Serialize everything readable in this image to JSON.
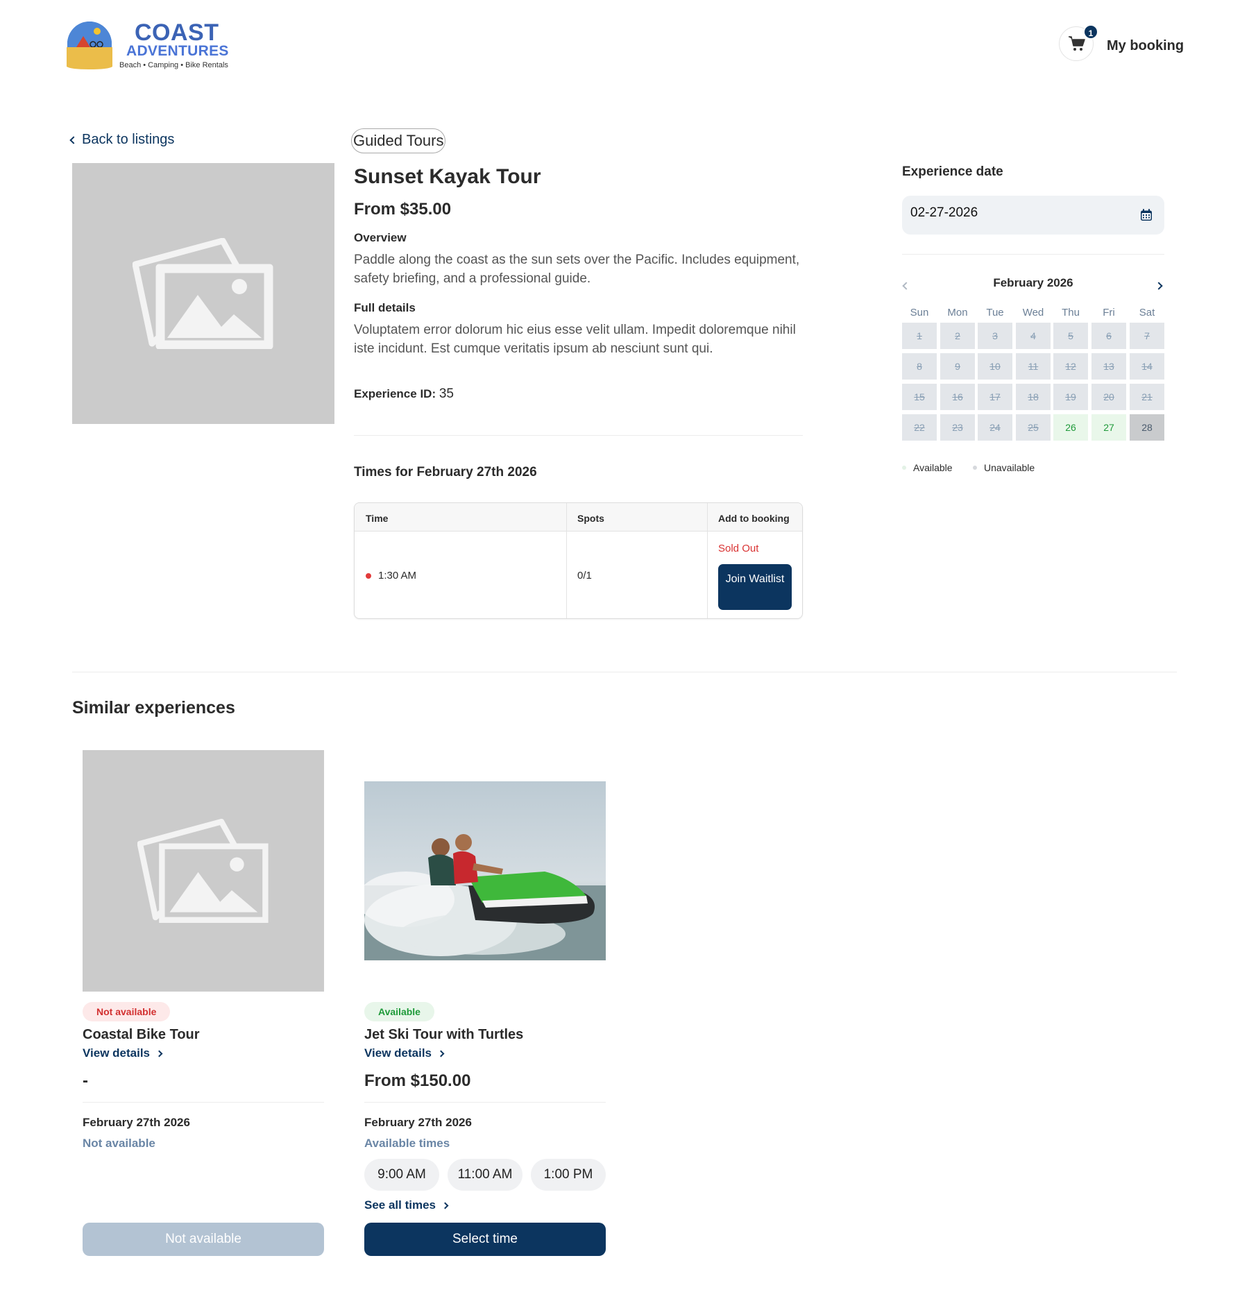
{
  "brand": {
    "name_line1": "COAST",
    "name_line2": "ADVENTURES",
    "tagline": "Beach • Camping • Bike Rentals"
  },
  "header": {
    "cart_count": "1",
    "my_booking_label": "My booking"
  },
  "back_label": "Back to listings",
  "experience": {
    "category": "Guided Tours",
    "title": "Sunset Kayak Tour",
    "price": "From $35.00",
    "overview_label": "Overview",
    "overview_text": "Paddle along the coast as the sun sets over the Pacific. Includes equipment, safety briefing, and a professional guide.",
    "full_details_label": "Full details",
    "full_details_text": "Voluptatem error dolorum hic eius esse velit ullam. Impedit doloremque nihil iste incidunt. Est cumque veritatis ipsum ab nesciunt sunt qui.",
    "id_label": "Experience ID:",
    "id_value": "35"
  },
  "times": {
    "heading": "Times for February 27th 2026",
    "headers": [
      "Time",
      "Spots",
      "Add to booking"
    ],
    "rows": [
      {
        "time": "1:30 AM",
        "spots": "0/1",
        "status": "Sold Out",
        "action": "Join Waitlist"
      }
    ]
  },
  "date_picker": {
    "label": "Experience date",
    "value": "02-27-2026",
    "month": "February 2026",
    "weekdays": [
      "Sun",
      "Mon",
      "Tue",
      "Wed",
      "Thu",
      "Fri",
      "Sat"
    ],
    "days": [
      {
        "d": "1",
        "s": "unavailable"
      },
      {
        "d": "2",
        "s": "unavailable"
      },
      {
        "d": "3",
        "s": "unavailable"
      },
      {
        "d": "4",
        "s": "unavailable"
      },
      {
        "d": "5",
        "s": "unavailable"
      },
      {
        "d": "6",
        "s": "unavailable"
      },
      {
        "d": "7",
        "s": "unavailable"
      },
      {
        "d": "8",
        "s": "unavailable"
      },
      {
        "d": "9",
        "s": "unavailable"
      },
      {
        "d": "10",
        "s": "unavailable"
      },
      {
        "d": "11",
        "s": "unavailable"
      },
      {
        "d": "12",
        "s": "unavailable"
      },
      {
        "d": "13",
        "s": "unavailable"
      },
      {
        "d": "14",
        "s": "unavailable"
      },
      {
        "d": "15",
        "s": "unavailable"
      },
      {
        "d": "16",
        "s": "unavailable"
      },
      {
        "d": "17",
        "s": "unavailable"
      },
      {
        "d": "18",
        "s": "unavailable"
      },
      {
        "d": "19",
        "s": "unavailable"
      },
      {
        "d": "20",
        "s": "unavailable"
      },
      {
        "d": "21",
        "s": "unavailable"
      },
      {
        "d": "22",
        "s": "unavailable"
      },
      {
        "d": "23",
        "s": "unavailable"
      },
      {
        "d": "24",
        "s": "unavailable"
      },
      {
        "d": "25",
        "s": "unavailable"
      },
      {
        "d": "26",
        "s": "available"
      },
      {
        "d": "27",
        "s": "available"
      },
      {
        "d": "28",
        "s": "selected"
      }
    ],
    "legend": [
      {
        "label": "Available",
        "color": "#e3f2e6"
      },
      {
        "label": "Unavailable",
        "color": "#d6d9dd"
      }
    ]
  },
  "similar": {
    "heading": "Similar experiences",
    "cards": [
      {
        "badge": "Not available",
        "title": "Coastal Bike Tour",
        "view_details": "View details",
        "price": "-",
        "date": "February 27th 2026",
        "sub": "Not available",
        "button": "Not available"
      },
      {
        "badge": "Available",
        "title": "Jet Ski Tour with Turtles",
        "view_details": "View details",
        "price": "From $150.00",
        "date": "February 27th 2026",
        "sub": "Available times",
        "times": [
          "9:00 AM",
          "11:00 AM",
          "1:00 PM"
        ],
        "see_all": "See all times",
        "button": "Select time"
      }
    ]
  },
  "colors": {
    "brand_navy": "#0c355f",
    "sold_out_red": "#d93232",
    "available_green": "#1f9a3a",
    "disabled_button": "#b3c3d3"
  }
}
